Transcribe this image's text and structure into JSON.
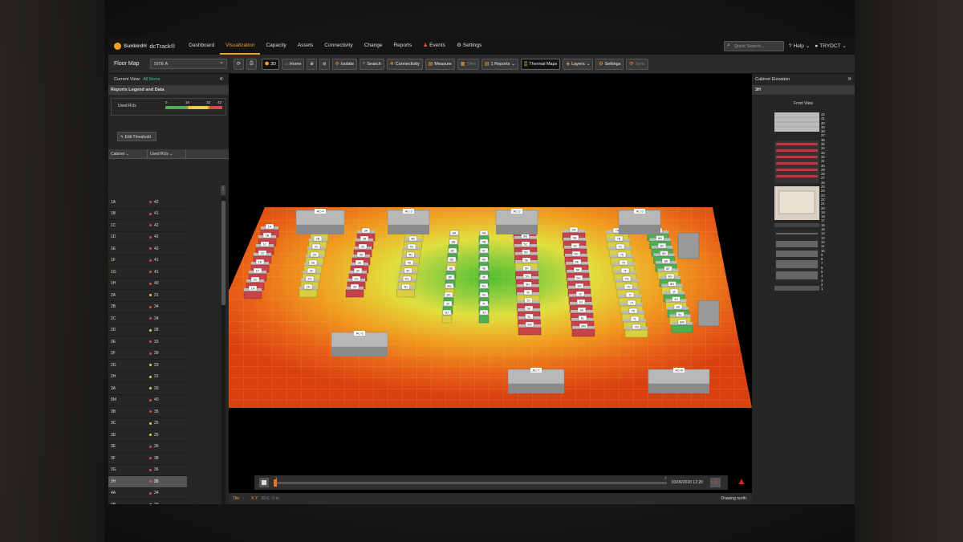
{
  "app": {
    "brand": "Sunbird®",
    "product": "dcTrack®",
    "nav": [
      "Dashboard",
      "Visualization",
      "Capacity",
      "Assets",
      "Connectivity",
      "Change",
      "Reports",
      "Events",
      "Settings"
    ],
    "active_nav": "Visualization",
    "quick_search_placeholder": "Quick Search...",
    "help": "Help",
    "user": "TRYDCT"
  },
  "toolbar": {
    "title": "Floor Map",
    "site": "SITE A",
    "buttons": [
      "3D",
      "Home",
      "Isolate",
      "Search",
      "Connectivity",
      "Measure",
      "Tiles",
      "1 Reports",
      "Thermal Maps",
      "Layers",
      "Settings",
      "Sync"
    ]
  },
  "left": {
    "current_view_label": "Current View:",
    "current_view": "All Items",
    "legend_title": "Reports Legend and Data",
    "metric": "Used RUs",
    "scale": [
      "0",
      "16",
      "32",
      "42"
    ],
    "edit_threshold": "Edit Threshold",
    "col_cabinet": "Cabinet",
    "col_used": "Used RUs",
    "rows": [
      {
        "cab": "1A",
        "val": "42",
        "c": "#e04848"
      },
      {
        "cab": "1B",
        "val": "41",
        "c": "#e04848"
      },
      {
        "cab": "1C",
        "val": "42",
        "c": "#e04848"
      },
      {
        "cab": "1D",
        "val": "42",
        "c": "#e04848"
      },
      {
        "cab": "1E",
        "val": "42",
        "c": "#e04848"
      },
      {
        "cab": "1F",
        "val": "41",
        "c": "#e04848"
      },
      {
        "cab": "1G",
        "val": "41",
        "c": "#e04848"
      },
      {
        "cab": "1H",
        "val": "40",
        "c": "#e04848"
      },
      {
        "cab": "2A",
        "val": "31",
        "c": "#e8d040"
      },
      {
        "cab": "2B",
        "val": "34",
        "c": "#e04848"
      },
      {
        "cab": "2C",
        "val": "34",
        "c": "#e04848"
      },
      {
        "cab": "2D",
        "val": "28",
        "c": "#e8d040"
      },
      {
        "cab": "2E",
        "val": "33",
        "c": "#e04848"
      },
      {
        "cab": "2F",
        "val": "39",
        "c": "#e04848"
      },
      {
        "cab": "2G",
        "val": "23",
        "c": "#e8d040"
      },
      {
        "cab": "2H",
        "val": "31",
        "c": "#e8d040"
      },
      {
        "cab": "3A",
        "val": "30",
        "c": "#e8d040"
      },
      {
        "cab": "5M",
        "val": "40",
        "c": "#e04848"
      },
      {
        "cab": "3B",
        "val": "35",
        "c": "#e04848"
      },
      {
        "cab": "3C",
        "val": "25",
        "c": "#e8d040"
      },
      {
        "cab": "3D",
        "val": "25",
        "c": "#e8d040"
      },
      {
        "cab": "3E",
        "val": "35",
        "c": "#e04848"
      },
      {
        "cab": "3F",
        "val": "38",
        "c": "#e04848"
      },
      {
        "cab": "3G",
        "val": "36",
        "c": "#e04848"
      },
      {
        "cab": "3H",
        "val": "35",
        "c": "#e04848"
      },
      {
        "cab": "4A",
        "val": "34",
        "c": "#e04848"
      },
      {
        "cab": "4B",
        "val": "20",
        "c": "#e8d040"
      },
      {
        "cab": "4C",
        "val": "35",
        "c": "#e04848"
      },
      {
        "cab": "7L",
        "val": "30",
        "c": "#e8d040"
      },
      {
        "cab": "4D",
        "val": "35",
        "c": "#e04848"
      }
    ],
    "selected": "3H"
  },
  "viewport": {
    "timeline_start": "1",
    "timeline_end": "7",
    "timeline_date": "03/06/2020 12:20",
    "tile_label": "Tile:",
    "tile_value": "-",
    "xy_label": "X,Y:",
    "xy_value": "33.6, -2 m",
    "drawing_north": "Drawing north:",
    "ac_units": [
      "AC-4",
      "AC-3",
      "AC-2",
      "AC-5",
      "AC-6",
      "AC-7",
      "AC-8"
    ],
    "rows": [
      {
        "labels": [
          "1A",
          "1B",
          "1C",
          "1D",
          "1E",
          "1F",
          "1G",
          "1H"
        ],
        "color": "red"
      },
      {
        "labels": [
          "2A",
          "2B",
          "2C",
          "2D",
          "2E",
          "2F",
          "2G",
          "2H"
        ],
        "color": "yellow"
      },
      {
        "labels": [
          "3A",
          "3B",
          "3C",
          "3D",
          "3E",
          "3F",
          "3G",
          "3H"
        ],
        "color": "red"
      },
      {
        "labels": [
          "4A",
          "4B",
          "4C",
          "4D",
          "4E",
          "4F",
          "4G",
          "4H"
        ],
        "color": "yellow"
      },
      {
        "labels": [
          "8A",
          "8B",
          "8C",
          "8D",
          "8E",
          "8F",
          "8G",
          "8H",
          "8I",
          "8J"
        ],
        "color": "mixed"
      },
      {
        "labels": [
          "4A",
          "4B",
          "4C",
          "4D",
          "4E",
          "4F",
          "4G",
          "4H",
          "4I",
          "4J"
        ],
        "color": "green"
      },
      {
        "labels": [
          "5A",
          "5B",
          "5C",
          "5D",
          "5E",
          "5F",
          "5G",
          "5H",
          "5I",
          "5J",
          "5K",
          "5L",
          "5M"
        ],
        "color": "red"
      },
      {
        "labels": [
          "6A",
          "6B",
          "6C",
          "6D",
          "6E",
          "6F",
          "6G",
          "6H",
          "6I",
          "6J",
          "6K",
          "6L",
          "6M"
        ],
        "color": "red"
      },
      {
        "labels": [
          "7A",
          "7B",
          "7C",
          "7D",
          "7E",
          "7F",
          "7G",
          "7H",
          "7I",
          "7J",
          "7K",
          "7L",
          "7M"
        ],
        "color": "yellow"
      },
      {
        "labels": [
          "8A",
          "8B",
          "8C",
          "8D",
          "8E",
          "8F",
          "8G",
          "8H",
          "8I",
          "8J",
          "8K",
          "8L",
          "8M"
        ],
        "color": "green"
      }
    ]
  },
  "right": {
    "title": "Cabinet Elevation",
    "cabinet": "3H",
    "front_view": "Front View",
    "ru_numbers": [
      "42",
      "41",
      "40",
      "39",
      "38",
      "37",
      "36",
      "35",
      "34",
      "33",
      "32",
      "31",
      "30",
      "29",
      "28",
      "27",
      "26",
      "25",
      "24",
      "23",
      "22",
      "21",
      "20",
      "19",
      "18",
      "17",
      "16",
      "15",
      "14",
      "13",
      "12",
      "11",
      "10",
      "9",
      "8",
      "7",
      "6",
      "5",
      "4",
      "3",
      "2",
      "1"
    ]
  },
  "colors": {
    "accent": "#f0a030",
    "red": "#e04848",
    "yellow": "#e8d040",
    "green": "#4caf50"
  }
}
